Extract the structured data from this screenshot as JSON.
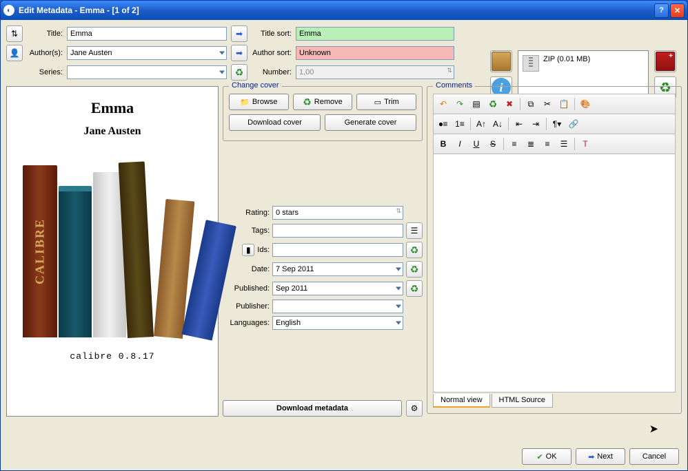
{
  "window": {
    "title": "Edit Metadata - Emma -  [1 of 2]"
  },
  "fields": {
    "title_label": "Title:",
    "title_value": "Emma",
    "title_sort_label": "Title sort:",
    "title_sort_value": "Emma",
    "authors_label": "Author(s):",
    "authors_value": "Jane Austen",
    "author_sort_label": "Author sort:",
    "author_sort_value": "Unknown",
    "series_label": "Series:",
    "series_value": "",
    "number_label": "Number:",
    "number_value": "1,00"
  },
  "cover": {
    "title": "Emma",
    "author": "Jane Austen",
    "footer": "calibre 0.8.17"
  },
  "change_cover": {
    "legend": "Change cover",
    "browse": "Browse",
    "remove": "Remove",
    "trim": "Trim",
    "download": "Download cover",
    "generate": "Generate cover"
  },
  "meta": {
    "rating_label": "Rating:",
    "rating_value": "0 stars",
    "tags_label": "Tags:",
    "tags_value": "",
    "ids_label": "Ids:",
    "ids_value": "",
    "date_label": "Date:",
    "date_value": "7 Sep 2011",
    "published_label": "Published:",
    "published_value": "Sep 2011",
    "publisher_label": "Publisher:",
    "publisher_value": "",
    "languages_label": "Languages:",
    "languages_value": "English",
    "download_metadata": "Download metadata"
  },
  "comments": {
    "legend": "Comments",
    "tab_normal": "Normal view",
    "tab_html": "HTML Source"
  },
  "formats": {
    "zip_label": "ZIP (0.01 MB)"
  },
  "buttons": {
    "ok": "OK",
    "next": "Next",
    "cancel": "Cancel"
  }
}
